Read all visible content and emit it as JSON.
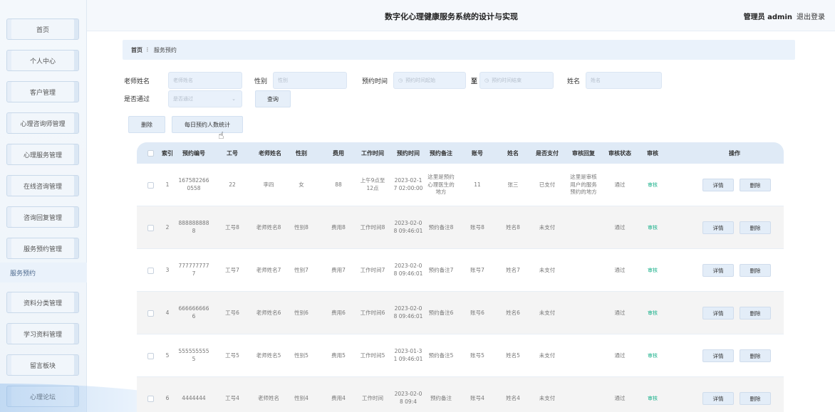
{
  "header": {
    "title": "数字化心理健康服务系统的设计与实现",
    "admin": "管理员 admin",
    "logout": "退出登录"
  },
  "sidebar": {
    "items": [
      "首页",
      "个人中心",
      "客户管理",
      "心理咨询师管理",
      "心理服务管理",
      "在线咨询管理",
      "咨询回复管理",
      "服务预约管理",
      "资料分类管理",
      "学习资料管理",
      "留言板块",
      "心理论坛"
    ],
    "sub_item": "服务预约"
  },
  "breadcrumb": {
    "home": "首页",
    "sep": "⠇",
    "current": "服务预约"
  },
  "search": {
    "teacher_label": "老师姓名",
    "teacher_placeholder": "老师姓名",
    "gender_label": "性别",
    "gender_placeholder": "性别",
    "time_label": "预约时间",
    "time_start_placeholder": "预约时间起始",
    "to": "至",
    "time_end_placeholder": "预约时间结束",
    "name_label": "姓名",
    "name_placeholder": "姓名",
    "passed_label": "是否通过",
    "passed_placeholder": "是否通过",
    "query_button": "查询"
  },
  "toolbar": {
    "delete_button": "删除",
    "stats_button": "每日预约人数统计"
  },
  "table": {
    "columns": [
      "索引",
      "预约编号",
      "工号",
      "老师姓名",
      "性别",
      "费用",
      "工作时间",
      "预约时间",
      "预约备注",
      "账号",
      "姓名",
      "是否支付",
      "审核回复",
      "审核状态",
      "审核",
      "操作"
    ],
    "detail_label": "详情",
    "delete_label": "删除",
    "rows": [
      {
        "idx": "1",
        "no": "1675822660558",
        "gh": "22",
        "teacher": "李四",
        "gender": "女",
        "fee": "88",
        "work": "上午9点至12点",
        "time": "2023-02-17 02:00:00",
        "note": "这里是预约心理医生的地方",
        "account": "11",
        "name": "张三",
        "paid": "已支付",
        "reply": "这里是审核用户的服务预约的地方",
        "status": "通过",
        "audit": "审核"
      },
      {
        "idx": "2",
        "no": "8888888888",
        "gh": "工号8",
        "teacher": "老师姓名8",
        "gender": "性别8",
        "fee": "费用8",
        "work": "工作时间8",
        "time": "2023-02-08 09:46:01",
        "note": "预约备注8",
        "account": "账号8",
        "name": "姓名8",
        "paid": "未支付",
        "reply": "",
        "status": "通过",
        "audit": "审核"
      },
      {
        "idx": "3",
        "no": "7777777777",
        "gh": "工号7",
        "teacher": "老师姓名7",
        "gender": "性别7",
        "fee": "费用7",
        "work": "工作时间7",
        "time": "2023-02-08 09:46:01",
        "note": "预约备注7",
        "account": "账号7",
        "name": "姓名7",
        "paid": "未支付",
        "reply": "",
        "status": "通过",
        "audit": "审核"
      },
      {
        "idx": "4",
        "no": "6666666666",
        "gh": "工号6",
        "teacher": "老师姓名6",
        "gender": "性别6",
        "fee": "费用6",
        "work": "工作时间6",
        "time": "2023-02-08 09:46:01",
        "note": "预约备注6",
        "account": "账号6",
        "name": "姓名6",
        "paid": "未支付",
        "reply": "",
        "status": "通过",
        "audit": "审核"
      },
      {
        "idx": "5",
        "no": "5555555555",
        "gh": "工号5",
        "teacher": "老师姓名5",
        "gender": "性别5",
        "fee": "费用5",
        "work": "工作时间5",
        "time": "2023-01-31 09:46:01",
        "note": "预约备注5",
        "account": "账号5",
        "name": "姓名5",
        "paid": "未支付",
        "reply": "",
        "status": "通过",
        "audit": "审核"
      },
      {
        "idx": "6",
        "no": "4444444",
        "gh": "工号4",
        "teacher": "老师姓名",
        "gender": "性别4",
        "fee": "费用4",
        "work": "工作时间",
        "time": "2023-02-08 09:4",
        "note": "预约备注",
        "account": "账号4",
        "name": "姓名4",
        "paid": "未支付",
        "reply": "",
        "status": "通过",
        "audit": "审核"
      }
    ]
  }
}
